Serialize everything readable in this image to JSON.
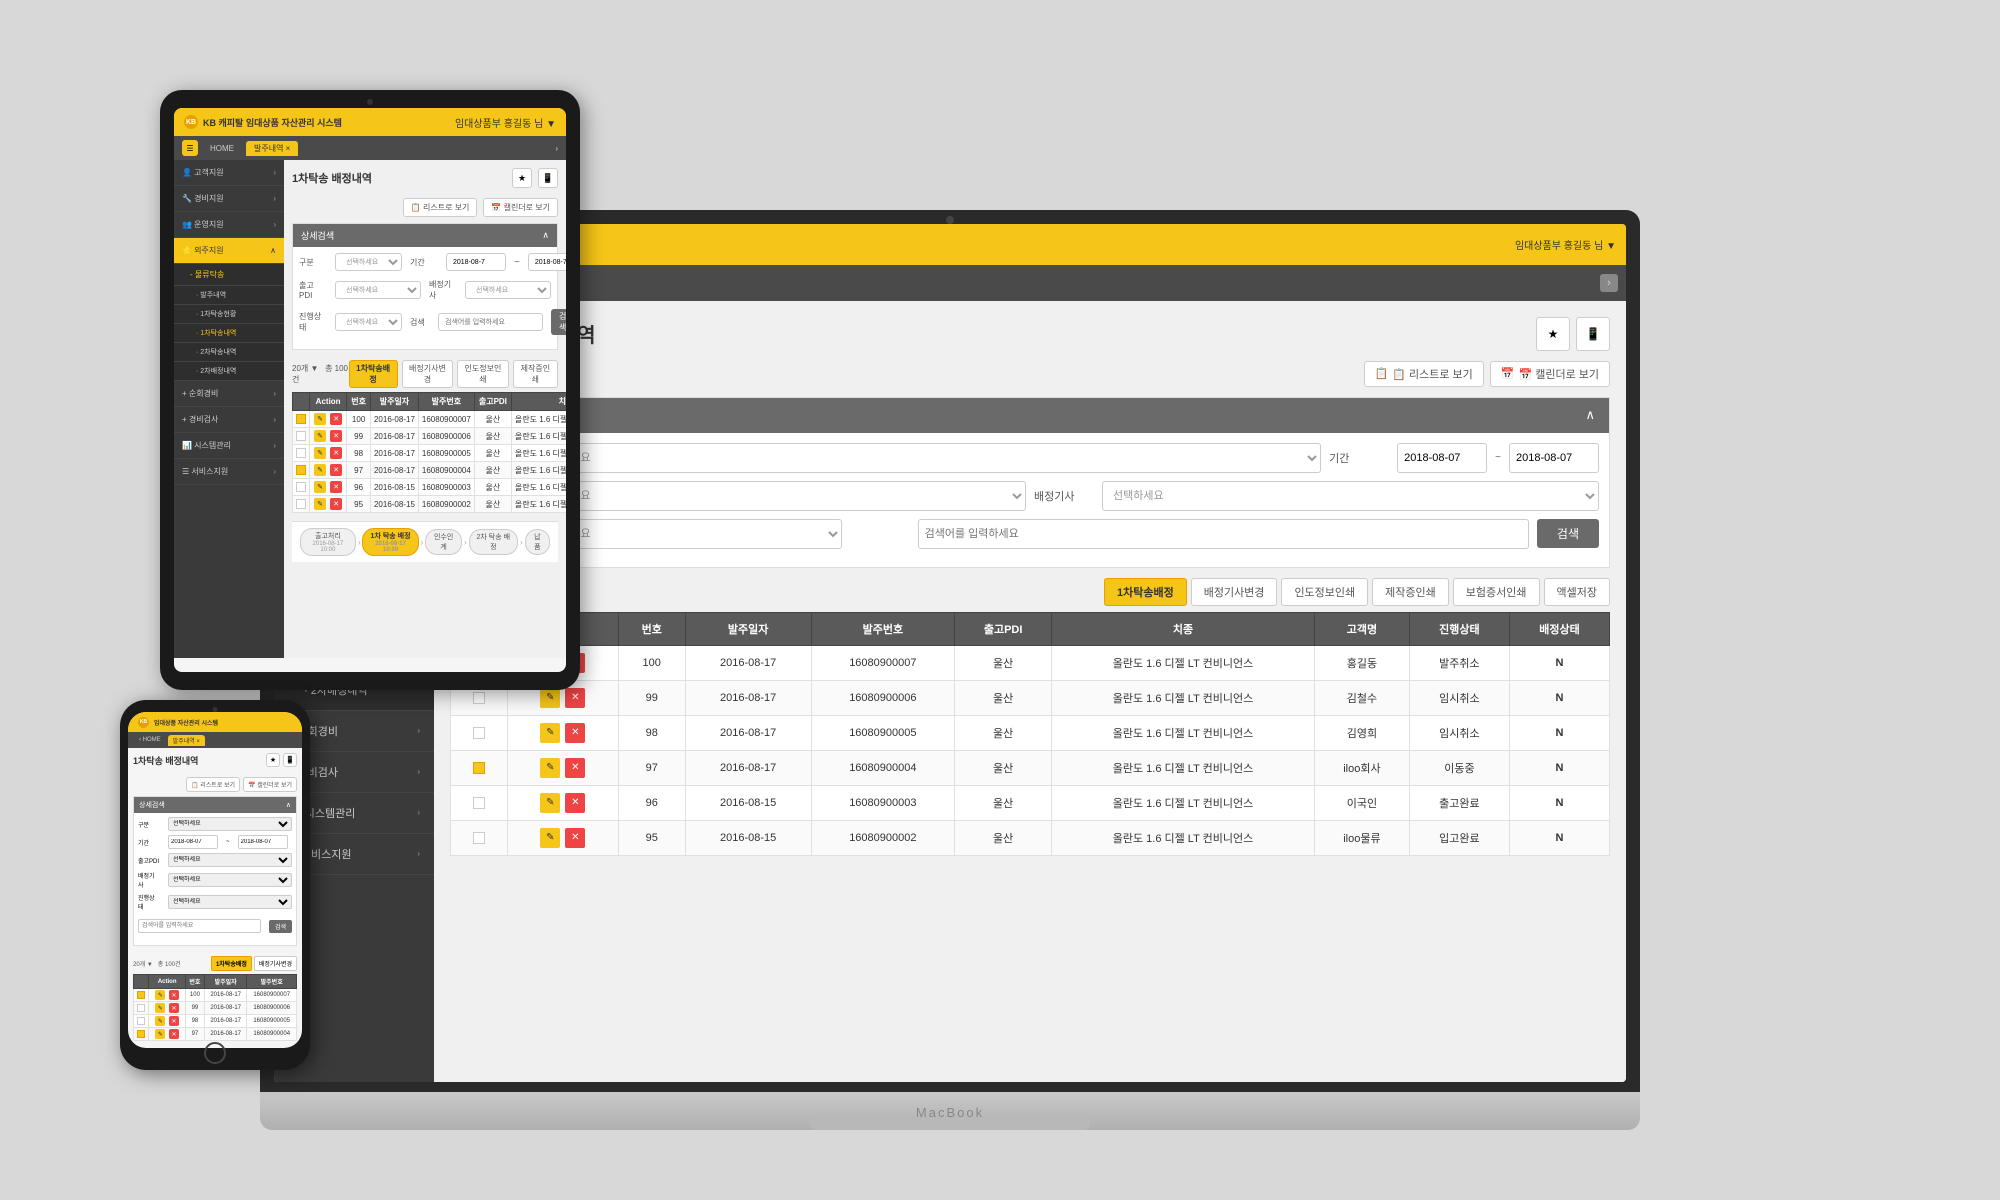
{
  "app": {
    "logo_text": "KB 캐피탈 임대상품 자산관리 시스템",
    "logo_icon": "KB",
    "header_right_laptop": "임대상품부 홍길동 님 ▼",
    "header_right_tablet": "임대상품부 홍길동 님 ▼",
    "nav": {
      "home_label": "HOME",
      "tab1_label": "발주내역",
      "tab1_close": "×"
    }
  },
  "sidebar": {
    "items": [
      {
        "label": "고객지원",
        "icon": "👤",
        "has_arrow": true
      },
      {
        "label": "경비지원",
        "icon": "🔧",
        "has_arrow": true
      },
      {
        "label": "운영지원",
        "icon": "👥",
        "has_arrow": true
      },
      {
        "label": "외주지원",
        "icon": "⭐",
        "has_arrow": true,
        "active": true
      },
      {
        "label": "- 물류탁송",
        "sub": true,
        "open": true
      },
      {
        "label": "· 발주내역",
        "sub": true,
        "subsub": true
      },
      {
        "label": "· 1차탁송현황",
        "sub": true,
        "subsub": true
      },
      {
        "label": "· 1차탁송내역",
        "sub": true,
        "subsub": true,
        "selected": true
      },
      {
        "label": "· 2차탁송내역",
        "sub": true,
        "subsub": true
      },
      {
        "label": "· 2차배정내역",
        "sub": true,
        "subsub": true
      },
      {
        "label": "순회경비",
        "icon": "+",
        "has_arrow": true
      },
      {
        "label": "경비검사",
        "icon": "+",
        "has_arrow": true
      },
      {
        "label": "시스템관리",
        "icon": "📊",
        "has_arrow": true
      },
      {
        "label": "서비스지원",
        "icon": "☰",
        "has_arrow": true
      }
    ]
  },
  "page": {
    "title": "1차탁송 배정내역",
    "view_list_btn": "📋 리스트로 보기",
    "view_calendar_btn": "📅 캘린더로 보기",
    "search_panel_title": "상세검색",
    "search_fields": {
      "gubun_label": "구분",
      "gubun_placeholder": "선택하세요",
      "period_label": "기간",
      "period_from": "2018-08-07",
      "period_to": "2018-08-07",
      "chulgo_label": "출고PDI",
      "chulgo_placeholder": "선택하세요",
      "baejung_label": "배정기사",
      "baejung_placeholder": "선택하세요",
      "jinhang_label": "진행상태",
      "jinhang_placeholder": "선택하세요",
      "search_keyword_placeholder": "검색어를 입력하세요",
      "search_btn": "검색"
    },
    "table_controls": {
      "per_page": "20개",
      "total": "총 100건",
      "btn1": "1차탁송배정",
      "btn2": "배정기사변경",
      "btn3": "인도정보인쇄",
      "btn4": "제작증인쇄",
      "btn5": "보험증서인쇄",
      "btn6": "액셀저장"
    },
    "table_headers": [
      "Action",
      "번호",
      "발주일자",
      "발주번호",
      "출고PDI",
      "치종",
      "고객명",
      "진행상태",
      "배정상태"
    ],
    "table_rows": [
      {
        "checked": true,
        "action_icons": [
          "✎",
          "✕"
        ],
        "number": "100",
        "date": "2016-08-17",
        "order_no": "16080900007",
        "pdi": "울산",
        "model": "올란도 1.6 디젤 LT 컨비니언스",
        "customer": "홍길동",
        "status": "발주취소",
        "assign_status": "N"
      },
      {
        "checked": false,
        "action_icons": [
          "✎",
          "✕"
        ],
        "number": "99",
        "date": "2016-08-17",
        "order_no": "16080900006",
        "pdi": "울산",
        "model": "올란도 1.6 디젤 LT 컨비니언스",
        "customer": "김철수",
        "status": "임시취소",
        "assign_status": "N"
      },
      {
        "checked": false,
        "action_icons": [
          "✎",
          "✕"
        ],
        "number": "98",
        "date": "2016-08-17",
        "order_no": "16080900005",
        "pdi": "울산",
        "model": "올란도 1.6 디젤 LT 컨비니언스",
        "customer": "김영희",
        "status": "임시취소",
        "assign_status": "N"
      },
      {
        "checked": true,
        "action_icons": [
          "✎",
          "✕"
        ],
        "number": "97",
        "date": "2016-08-17",
        "order_no": "16080900004",
        "pdi": "울산",
        "model": "올란도 1.6 디젤 LT 컨비니언스",
        "customer": "iloo회사",
        "status": "이동중",
        "assign_status": "N"
      },
      {
        "checked": false,
        "action_icons": [
          "✎",
          "✕"
        ],
        "number": "96",
        "date": "2016-08-15",
        "order_no": "16080900003",
        "pdi": "울산",
        "model": "올란도 1.6 디젤 LT 컨비니언스",
        "customer": "이국인",
        "status": "출고완료",
        "assign_status": "N"
      },
      {
        "checked": false,
        "action_icons": [
          "✎",
          "✕"
        ],
        "number": "95",
        "date": "2016-08-15",
        "order_no": "16080900002",
        "pdi": "울산",
        "model": "올란도 1.6 디젤 LT 컨비니언스",
        "customer": "iloo물류",
        "status": "입고완료",
        "assign_status": "N"
      }
    ]
  },
  "macbook_label": "MacBook",
  "process_flow": {
    "steps": [
      {
        "label": "출고처리",
        "date": "2016-08-17\n10:00",
        "active": false
      },
      {
        "label": "1차 탁송\n배정",
        "date": "2016-08-17\n10:00",
        "active": true
      },
      {
        "label": "인수인계",
        "date": "",
        "active": false
      },
      {
        "label": "2차 탁송\n배정",
        "date": "",
        "active": false
      },
      {
        "label": "납품",
        "date": "",
        "active": false
      }
    ]
  }
}
